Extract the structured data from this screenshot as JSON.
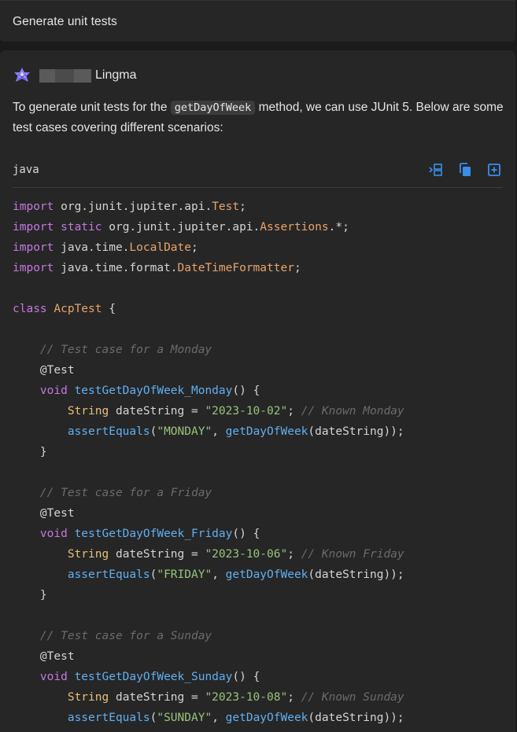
{
  "prompt": {
    "text": "Generate unit tests"
  },
  "reply": {
    "author_name": "Lingma",
    "intro_before": "To generate unit tests for the ",
    "intro_code": "getDayOfWeek",
    "intro_after": " method, we can use JUnit 5. Below are some test cases covering different scenarios:",
    "code_block": {
      "language": "java",
      "actions": [
        "insert-icon",
        "copy-icon",
        "new-file-icon"
      ],
      "lines": [
        [
          [
            "kw",
            "import"
          ],
          [
            "p",
            " org.junit.jupiter.api."
          ],
          [
            "cls",
            "Test"
          ],
          [
            "p",
            ";"
          ]
        ],
        [
          [
            "kw",
            "import static"
          ],
          [
            "p",
            " org.junit.jupiter.api."
          ],
          [
            "cls",
            "Assertions"
          ],
          [
            "p",
            ".*;"
          ]
        ],
        [
          [
            "kw",
            "import"
          ],
          [
            "p",
            " java.time."
          ],
          [
            "cls",
            "LocalDate"
          ],
          [
            "p",
            ";"
          ]
        ],
        [
          [
            "kw",
            "import"
          ],
          [
            "p",
            " java.time.format."
          ],
          [
            "cls",
            "DateTimeFormatter"
          ],
          [
            "p",
            ";"
          ]
        ],
        [],
        [
          [
            "kw",
            "class"
          ],
          [
            "p",
            " "
          ],
          [
            "cls",
            "AcpTest"
          ],
          [
            "p",
            " {"
          ]
        ],
        [],
        [
          [
            "p",
            "    "
          ],
          [
            "cmt",
            "// Test case for a Monday"
          ]
        ],
        [
          [
            "p",
            "    "
          ],
          [
            "ann",
            "@Test"
          ]
        ],
        [
          [
            "p",
            "    "
          ],
          [
            "kw",
            "void"
          ],
          [
            "p",
            " "
          ],
          [
            "fn",
            "testGetDayOfWeek_Monday"
          ],
          [
            "p",
            "() {"
          ]
        ],
        [
          [
            "p",
            "        "
          ],
          [
            "typ",
            "String"
          ],
          [
            "p",
            " dateString = "
          ],
          [
            "str",
            "\"2023-10-02\""
          ],
          [
            "p",
            "; "
          ],
          [
            "cmt",
            "// Known Monday"
          ]
        ],
        [
          [
            "p",
            "        "
          ],
          [
            "fn",
            "assertEquals"
          ],
          [
            "p",
            "("
          ],
          [
            "str",
            "\"MONDAY\""
          ],
          [
            "p",
            ", "
          ],
          [
            "fn",
            "getDayOfWeek"
          ],
          [
            "p",
            "(dateString));"
          ]
        ],
        [
          [
            "p",
            "    }"
          ]
        ],
        [],
        [
          [
            "p",
            "    "
          ],
          [
            "cmt",
            "// Test case for a Friday"
          ]
        ],
        [
          [
            "p",
            "    "
          ],
          [
            "ann",
            "@Test"
          ]
        ],
        [
          [
            "p",
            "    "
          ],
          [
            "kw",
            "void"
          ],
          [
            "p",
            " "
          ],
          [
            "fn",
            "testGetDayOfWeek_Friday"
          ],
          [
            "p",
            "() {"
          ]
        ],
        [
          [
            "p",
            "        "
          ],
          [
            "typ",
            "String"
          ],
          [
            "p",
            " dateString = "
          ],
          [
            "str",
            "\"2023-10-06\""
          ],
          [
            "p",
            "; "
          ],
          [
            "cmt",
            "// Known Friday"
          ]
        ],
        [
          [
            "p",
            "        "
          ],
          [
            "fn",
            "assertEquals"
          ],
          [
            "p",
            "("
          ],
          [
            "str",
            "\"FRIDAY\""
          ],
          [
            "p",
            ", "
          ],
          [
            "fn",
            "getDayOfWeek"
          ],
          [
            "p",
            "(dateString));"
          ]
        ],
        [
          [
            "p",
            "    }"
          ]
        ],
        [],
        [
          [
            "p",
            "    "
          ],
          [
            "cmt",
            "// Test case for a Sunday"
          ]
        ],
        [
          [
            "p",
            "    "
          ],
          [
            "ann",
            "@Test"
          ]
        ],
        [
          [
            "p",
            "    "
          ],
          [
            "kw",
            "void"
          ],
          [
            "p",
            " "
          ],
          [
            "fn",
            "testGetDayOfWeek_Sunday"
          ],
          [
            "p",
            "() {"
          ]
        ],
        [
          [
            "p",
            "        "
          ],
          [
            "typ",
            "String"
          ],
          [
            "p",
            " dateString = "
          ],
          [
            "str",
            "\"2023-10-08\""
          ],
          [
            "p",
            "; "
          ],
          [
            "cmt",
            "// Known Sunday"
          ]
        ],
        [
          [
            "p",
            "        "
          ],
          [
            "fn",
            "assertEquals"
          ],
          [
            "p",
            "("
          ],
          [
            "str",
            "\"SUNDAY\""
          ],
          [
            "p",
            ", "
          ],
          [
            "fn",
            "getDayOfWeek"
          ],
          [
            "p",
            "(dateString));"
          ]
        ]
      ]
    }
  },
  "colors": {
    "background": "#1b1b1c",
    "card": "#262627",
    "icon_accent": "#3b8eea",
    "logo_accent": "#8a7dff"
  }
}
